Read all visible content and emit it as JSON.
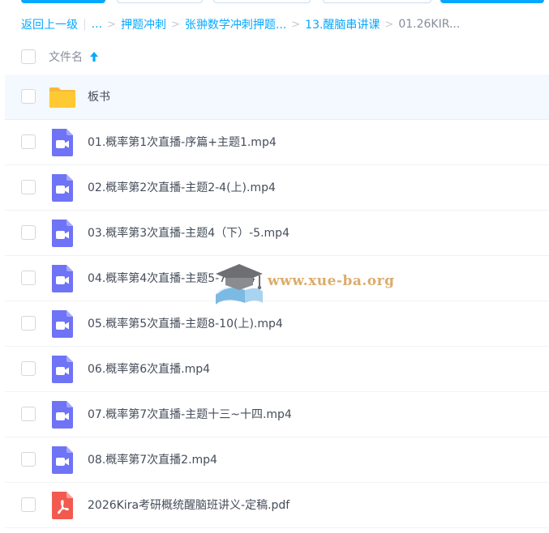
{
  "breadcrumb": {
    "back": "返回上一级",
    "ellipsis": "...",
    "items": [
      "押题冲刺",
      "张翀数学冲刺押题...",
      "13.醒脑串讲课"
    ],
    "current": "01.26KIR..."
  },
  "header": {
    "column_label": "文件名",
    "sort": "ascending"
  },
  "files": [
    {
      "name": "板书",
      "type": "folder"
    },
    {
      "name": "01.概率第1次直播-序篇+主题1.mp4",
      "type": "video"
    },
    {
      "name": "02.概率第2次直播-主题2-4(上).mp4",
      "type": "video"
    },
    {
      "name": "03.概率第3次直播-主题4（下）-5.mp4",
      "type": "video"
    },
    {
      "name": "04.概率第4次直播-主题5-7.mp4",
      "type": "video"
    },
    {
      "name": "05.概率第5次直播-主题8-10(上).mp4",
      "type": "video"
    },
    {
      "name": "06.概率第6次直播.mp4",
      "type": "video"
    },
    {
      "name": "07.概率第7次直播-主题十三~十四.mp4",
      "type": "video"
    },
    {
      "name": "08.概率第7次直播2.mp4",
      "type": "video"
    },
    {
      "name": "2026Kira考研概统醒脑班讲义-定稿.pdf",
      "type": "pdf"
    }
  ],
  "watermark": {
    "text": "www.xue-ba.org"
  },
  "colors": {
    "accent": "#06a7ff",
    "folder": "#ffc933",
    "video": "#6f73f6",
    "pdf": "#f25a4f",
    "highlight_row": "#f4f8ff"
  }
}
